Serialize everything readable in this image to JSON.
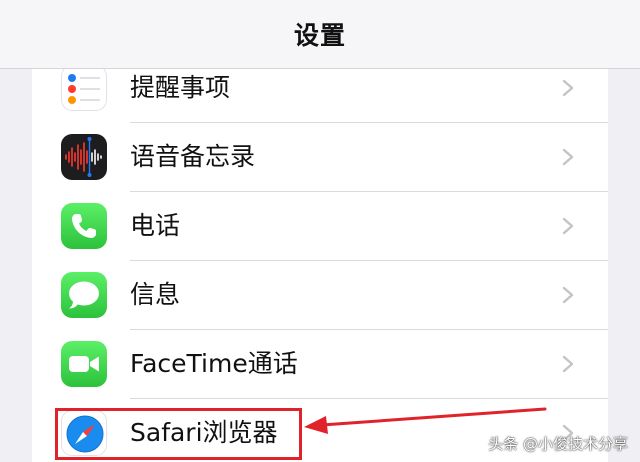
{
  "nav": {
    "title": "设置"
  },
  "rows": [
    {
      "label": "提醒事项",
      "icon": "reminders-icon"
    },
    {
      "label": "语音备忘录",
      "icon": "voice-memos-icon"
    },
    {
      "label": "电话",
      "icon": "phone-icon"
    },
    {
      "label": "信息",
      "icon": "messages-icon"
    },
    {
      "label": "FaceTime通话",
      "icon": "facetime-icon"
    },
    {
      "label": "Safari浏览器",
      "icon": "safari-icon"
    }
  ],
  "annotation": {
    "highlight_color": "#e0232b"
  },
  "watermark": {
    "text": "头条 @小俊技术分享"
  },
  "colors": {
    "accent_green": "#34c759",
    "background": "#efeff4",
    "annotation_red": "#e0232b"
  }
}
